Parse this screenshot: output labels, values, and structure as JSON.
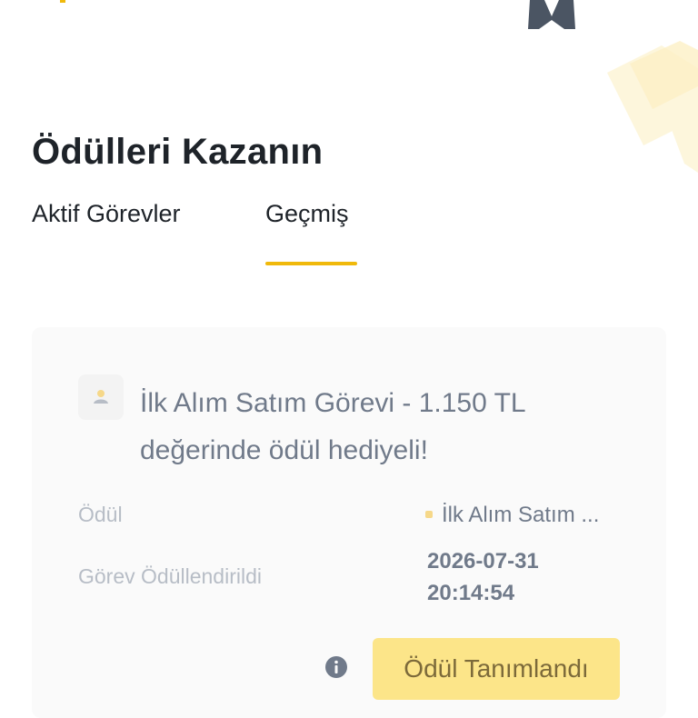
{
  "header": {
    "title": "Ödülleri Kazanın"
  },
  "tabs": [
    {
      "label": "Aktif Görevler",
      "active": false
    },
    {
      "label": "Geçmiş",
      "active": true
    }
  ],
  "task_card": {
    "icon": "reward-task-icon",
    "title": "İlk Alım Satım Görevi - 1.150 TL değerinde ödül hediyeli!",
    "reward_label": "Ödül",
    "reward_value": "İlk Alım Satım ...",
    "rewarded_label": "Görev Ödüllendirildi",
    "rewarded_date": "2026-07-31",
    "rewarded_time": "20:14:54",
    "info_icon": "info-icon",
    "status_button": "Ödül Tanımlandı"
  },
  "colors": {
    "accent": "#f0b90b",
    "button_bg": "#fce589",
    "button_text": "#7c6a3a",
    "card_bg": "#fafafa"
  }
}
